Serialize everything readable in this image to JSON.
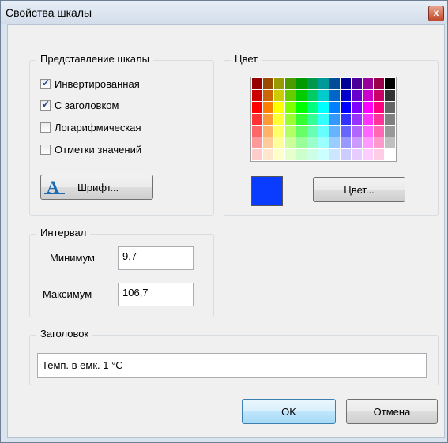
{
  "window": {
    "title": "Свойства шкалы",
    "close_glyph": "x"
  },
  "scale_view": {
    "legend": "Представление шкалы",
    "options": [
      {
        "label": "Инвертированная",
        "checked": true
      },
      {
        "label": "С заголовком",
        "checked": true
      },
      {
        "label": "Логарифмическая",
        "checked": false
      },
      {
        "label": "Отметки значений",
        "checked": false
      }
    ],
    "font_button": "Шрифт...",
    "font_icon": "font-letter-a-icon"
  },
  "color": {
    "legend": "Цвет",
    "button": "Цвет...",
    "selected": "#0a3cff",
    "palette": [
      [
        "#990000",
        "#994c00",
        "#999900",
        "#4c9900",
        "#009900",
        "#00994c",
        "#009999",
        "#004c99",
        "#000099",
        "#4c0099",
        "#990099",
        "#990049",
        "#000000"
      ],
      [
        "#cc0000",
        "#cc6600",
        "#cccc00",
        "#66cc00",
        "#00cc00",
        "#00cc66",
        "#00cccc",
        "#0066cc",
        "#0000cc",
        "#6600cc",
        "#cc00cc",
        "#cc0066",
        "#333333"
      ],
      [
        "#ff0000",
        "#ff8000",
        "#ffff00",
        "#80ff00",
        "#00ff00",
        "#00ff80",
        "#00ffff",
        "#0080ff",
        "#0000ff",
        "#8000ff",
        "#ff00ff",
        "#ff0080",
        "#666666"
      ],
      [
        "#ff3333",
        "#ff9933",
        "#ffff33",
        "#99ff33",
        "#33ff33",
        "#33ff99",
        "#33ffff",
        "#3399ff",
        "#3333ff",
        "#9933ff",
        "#ff33ff",
        "#ff3399",
        "#808080"
      ],
      [
        "#ff6666",
        "#ffb366",
        "#ffff66",
        "#b3ff66",
        "#66ff66",
        "#66ffb3",
        "#66ffff",
        "#66b3ff",
        "#6666ff",
        "#b366ff",
        "#ff66ff",
        "#ff66b3",
        "#999999"
      ],
      [
        "#ff9999",
        "#ffcc99",
        "#ffff99",
        "#ccff99",
        "#99ff99",
        "#99ffcc",
        "#99ffff",
        "#99ccff",
        "#9999ff",
        "#cc99ff",
        "#ff99ff",
        "#ff99cc",
        "#c0c0c0"
      ],
      [
        "#ffcccc",
        "#ffe6cc",
        "#ffffcc",
        "#e6ffcc",
        "#ccffcc",
        "#ccffe6",
        "#ccffff",
        "#cce6ff",
        "#ccccff",
        "#e6ccff",
        "#ffccff",
        "#ffcce6",
        "#ffffff"
      ]
    ]
  },
  "interval": {
    "legend": "Интервал",
    "min_label": "Минимум",
    "min_value": "9,7",
    "max_label": "Максимум",
    "max_value": "106,7"
  },
  "caption": {
    "legend": "Заголовок",
    "value": "Темп. в емк. 1 °C"
  },
  "buttons": {
    "ok": "OK",
    "cancel": "Отмена"
  }
}
